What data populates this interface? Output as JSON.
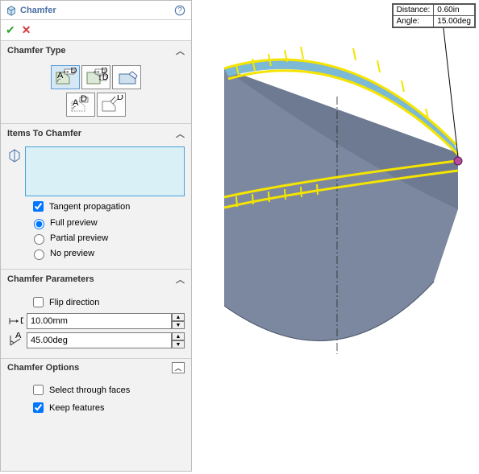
{
  "titlebar": {
    "title": "Chamfer"
  },
  "sections": {
    "type": {
      "heading": "Chamfer Type"
    },
    "items": {
      "heading": "Items To Chamfer",
      "tangent_label": "Tangent propagation",
      "full_label": "Full preview",
      "partial_label": "Partial preview",
      "none_label": "No preview"
    },
    "params": {
      "heading": "Chamfer Parameters",
      "flip_label": "Flip direction",
      "distance_value": "10.00mm",
      "angle_value": "45.00deg"
    },
    "options": {
      "heading": "Chamfer Options",
      "select_through_label": "Select through faces",
      "keep_label": "Keep features"
    }
  },
  "callout": {
    "distance_label": "Distance:",
    "distance_value": "0.60in",
    "angle_label": "Angle:",
    "angle_value": "15.00deg"
  },
  "state": {
    "tangent_checked": true,
    "preview": "full",
    "flip_checked": false,
    "select_through_checked": false,
    "keep_checked": true,
    "selected_type": 0
  }
}
